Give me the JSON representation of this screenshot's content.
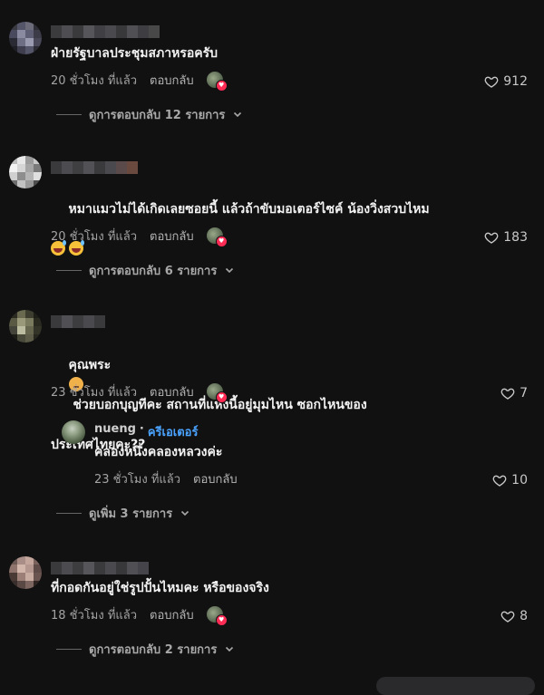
{
  "comments": [
    {
      "text": "ฝ่ายรัฐบาลประชุมสภาหรอครับ",
      "time": "20 ชั่วโมง ที่แล้ว",
      "reply_label": "ตอบกลับ",
      "likes": "912",
      "view_replies": "ดูการตอบกลับ 12 รายการ"
    },
    {
      "text": "หมาแมวไม่ได้เกิดเลยซอยนี้ แล้วถ้าขับมอเตอร์ไซค์ น้องวิ่งสวบไหม",
      "time": "20 ชั่วโมง ที่แล้ว",
      "reply_label": "ตอบกลับ",
      "likes": "183",
      "view_replies": "ดูการตอบกลับ 6 รายการ"
    },
    {
      "text_a": "คุณพระ",
      "text_b": " ช่วยบอกบุญทีคะ สถานที่แห่งนี้อยู่มุมไหน ซอกไหนของ",
      "text_c": "ประเทศไทยคะ??",
      "time": "23 ชั่วโมง ที่แล้ว",
      "reply_label": "ตอบกลับ",
      "likes": "7",
      "reply": {
        "name": "nueng",
        "sep": "·",
        "badge": "ครีเอเตอร์",
        "text": "คลองหนึ่งคลองหลวงค่ะ",
        "time": "23 ชั่วโมง ที่แล้ว",
        "reply_label": "ตอบกลับ",
        "likes": "10"
      },
      "view_replies": "ดูเพิ่ม 3 รายการ"
    },
    {
      "text": "ที่กอดกันอยู่ใช่รูปปั้นไหมคะ หรือของจริง",
      "time": "18 ชั่วโมง ที่แล้ว",
      "reply_label": "ตอบกลับ",
      "likes": "8",
      "view_replies": "ดูการตอบกลับ 2 รายการ"
    }
  ],
  "colors": {
    "background": "#111112",
    "creator_badge": "#4aa3ff",
    "heart_badge": "#fe2c55"
  },
  "icons": {
    "like": "heart-outline-icon",
    "expand": "chevron-down-icon",
    "heart_badge": "heart-badge-icon",
    "emoji_laugh": "grinning-sweat-emoji",
    "emoji_flushed": "flushed-face-emoji"
  }
}
